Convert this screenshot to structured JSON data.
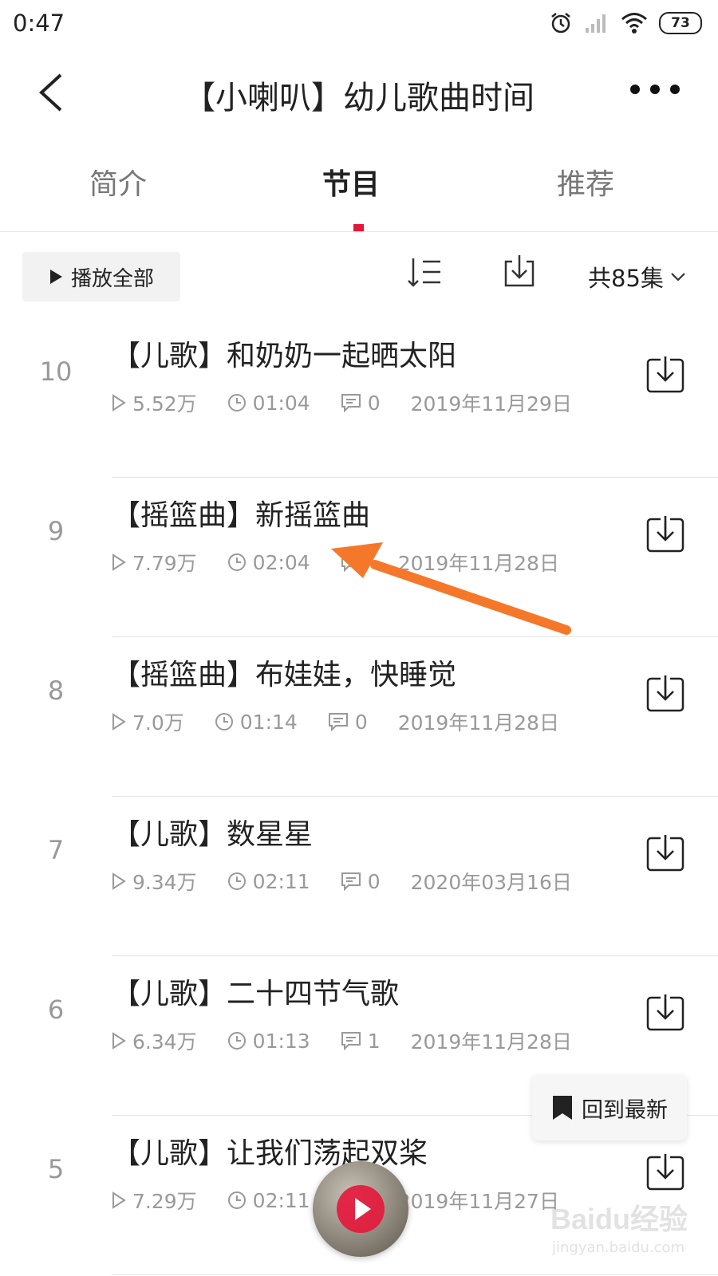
{
  "status_bar": {
    "time": "0:47",
    "battery": "73"
  },
  "header": {
    "title": "【小喇叭】幼儿歌曲时间"
  },
  "tabs": [
    {
      "label": "简介",
      "active": false
    },
    {
      "label": "节目",
      "active": true
    },
    {
      "label": "推荐",
      "active": false
    }
  ],
  "toolbar": {
    "play_all": "播放全部",
    "count": "共85集"
  },
  "episodes": [
    {
      "index": "10",
      "title": "【儿歌】和奶奶一起晒太阳",
      "plays": "5.52万",
      "duration": "01:04",
      "comments": "0",
      "date": "2019年11月29日"
    },
    {
      "index": "9",
      "title": "【摇篮曲】新摇篮曲",
      "plays": "7.79万",
      "duration": "02:04",
      "comments": "",
      "date": "2019年11月28日"
    },
    {
      "index": "8",
      "title": "【摇篮曲】布娃娃，快睡觉",
      "plays": "7.0万",
      "duration": "01:14",
      "comments": "0",
      "date": "2019年11月28日"
    },
    {
      "index": "7",
      "title": "【儿歌】数星星",
      "plays": "9.34万",
      "duration": "02:11",
      "comments": "0",
      "date": "2020年03月16日"
    },
    {
      "index": "6",
      "title": "【儿歌】二十四节气歌",
      "plays": "6.34万",
      "duration": "01:13",
      "comments": "1",
      "date": "2019年11月28日"
    },
    {
      "index": "5",
      "title": "【儿歌】让我们荡起双桨",
      "plays": "7.29万",
      "duration": "02:11",
      "comments": "",
      "date": "2019年11月27日"
    }
  ],
  "back_to_latest": "回到最新",
  "watermark": {
    "brand": "Baidu经验",
    "url": "jingyan.baidu.com"
  },
  "colors": {
    "accent": "#e6163b",
    "arrow": "#f5782a"
  }
}
